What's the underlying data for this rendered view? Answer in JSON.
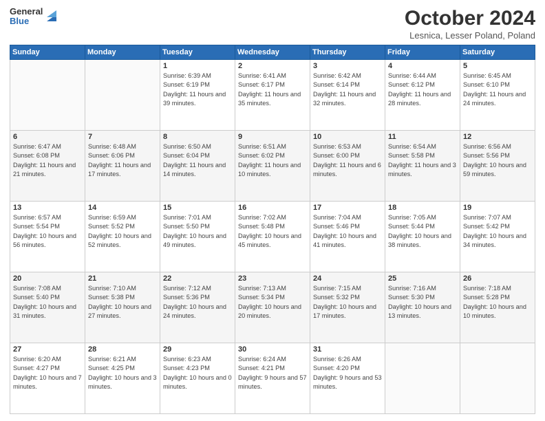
{
  "logo": {
    "general": "General",
    "blue": "Blue"
  },
  "header": {
    "month": "October 2024",
    "location": "Lesnica, Lesser Poland, Poland"
  },
  "weekdays": [
    "Sunday",
    "Monday",
    "Tuesday",
    "Wednesday",
    "Thursday",
    "Friday",
    "Saturday"
  ],
  "weeks": [
    [
      {
        "day": "",
        "info": ""
      },
      {
        "day": "",
        "info": ""
      },
      {
        "day": "1",
        "info": "Sunrise: 6:39 AM\nSunset: 6:19 PM\nDaylight: 11 hours and 39 minutes."
      },
      {
        "day": "2",
        "info": "Sunrise: 6:41 AM\nSunset: 6:17 PM\nDaylight: 11 hours and 35 minutes."
      },
      {
        "day": "3",
        "info": "Sunrise: 6:42 AM\nSunset: 6:14 PM\nDaylight: 11 hours and 32 minutes."
      },
      {
        "day": "4",
        "info": "Sunrise: 6:44 AM\nSunset: 6:12 PM\nDaylight: 11 hours and 28 minutes."
      },
      {
        "day": "5",
        "info": "Sunrise: 6:45 AM\nSunset: 6:10 PM\nDaylight: 11 hours and 24 minutes."
      }
    ],
    [
      {
        "day": "6",
        "info": "Sunrise: 6:47 AM\nSunset: 6:08 PM\nDaylight: 11 hours and 21 minutes."
      },
      {
        "day": "7",
        "info": "Sunrise: 6:48 AM\nSunset: 6:06 PM\nDaylight: 11 hours and 17 minutes."
      },
      {
        "day": "8",
        "info": "Sunrise: 6:50 AM\nSunset: 6:04 PM\nDaylight: 11 hours and 14 minutes."
      },
      {
        "day": "9",
        "info": "Sunrise: 6:51 AM\nSunset: 6:02 PM\nDaylight: 11 hours and 10 minutes."
      },
      {
        "day": "10",
        "info": "Sunrise: 6:53 AM\nSunset: 6:00 PM\nDaylight: 11 hours and 6 minutes."
      },
      {
        "day": "11",
        "info": "Sunrise: 6:54 AM\nSunset: 5:58 PM\nDaylight: 11 hours and 3 minutes."
      },
      {
        "day": "12",
        "info": "Sunrise: 6:56 AM\nSunset: 5:56 PM\nDaylight: 10 hours and 59 minutes."
      }
    ],
    [
      {
        "day": "13",
        "info": "Sunrise: 6:57 AM\nSunset: 5:54 PM\nDaylight: 10 hours and 56 minutes."
      },
      {
        "day": "14",
        "info": "Sunrise: 6:59 AM\nSunset: 5:52 PM\nDaylight: 10 hours and 52 minutes."
      },
      {
        "day": "15",
        "info": "Sunrise: 7:01 AM\nSunset: 5:50 PM\nDaylight: 10 hours and 49 minutes."
      },
      {
        "day": "16",
        "info": "Sunrise: 7:02 AM\nSunset: 5:48 PM\nDaylight: 10 hours and 45 minutes."
      },
      {
        "day": "17",
        "info": "Sunrise: 7:04 AM\nSunset: 5:46 PM\nDaylight: 10 hours and 41 minutes."
      },
      {
        "day": "18",
        "info": "Sunrise: 7:05 AM\nSunset: 5:44 PM\nDaylight: 10 hours and 38 minutes."
      },
      {
        "day": "19",
        "info": "Sunrise: 7:07 AM\nSunset: 5:42 PM\nDaylight: 10 hours and 34 minutes."
      }
    ],
    [
      {
        "day": "20",
        "info": "Sunrise: 7:08 AM\nSunset: 5:40 PM\nDaylight: 10 hours and 31 minutes."
      },
      {
        "day": "21",
        "info": "Sunrise: 7:10 AM\nSunset: 5:38 PM\nDaylight: 10 hours and 27 minutes."
      },
      {
        "day": "22",
        "info": "Sunrise: 7:12 AM\nSunset: 5:36 PM\nDaylight: 10 hours and 24 minutes."
      },
      {
        "day": "23",
        "info": "Sunrise: 7:13 AM\nSunset: 5:34 PM\nDaylight: 10 hours and 20 minutes."
      },
      {
        "day": "24",
        "info": "Sunrise: 7:15 AM\nSunset: 5:32 PM\nDaylight: 10 hours and 17 minutes."
      },
      {
        "day": "25",
        "info": "Sunrise: 7:16 AM\nSunset: 5:30 PM\nDaylight: 10 hours and 13 minutes."
      },
      {
        "day": "26",
        "info": "Sunrise: 7:18 AM\nSunset: 5:28 PM\nDaylight: 10 hours and 10 minutes."
      }
    ],
    [
      {
        "day": "27",
        "info": "Sunrise: 6:20 AM\nSunset: 4:27 PM\nDaylight: 10 hours and 7 minutes."
      },
      {
        "day": "28",
        "info": "Sunrise: 6:21 AM\nSunset: 4:25 PM\nDaylight: 10 hours and 3 minutes."
      },
      {
        "day": "29",
        "info": "Sunrise: 6:23 AM\nSunset: 4:23 PM\nDaylight: 10 hours and 0 minutes."
      },
      {
        "day": "30",
        "info": "Sunrise: 6:24 AM\nSunset: 4:21 PM\nDaylight: 9 hours and 57 minutes."
      },
      {
        "day": "31",
        "info": "Sunrise: 6:26 AM\nSunset: 4:20 PM\nDaylight: 9 hours and 53 minutes."
      },
      {
        "day": "",
        "info": ""
      },
      {
        "day": "",
        "info": ""
      }
    ]
  ]
}
